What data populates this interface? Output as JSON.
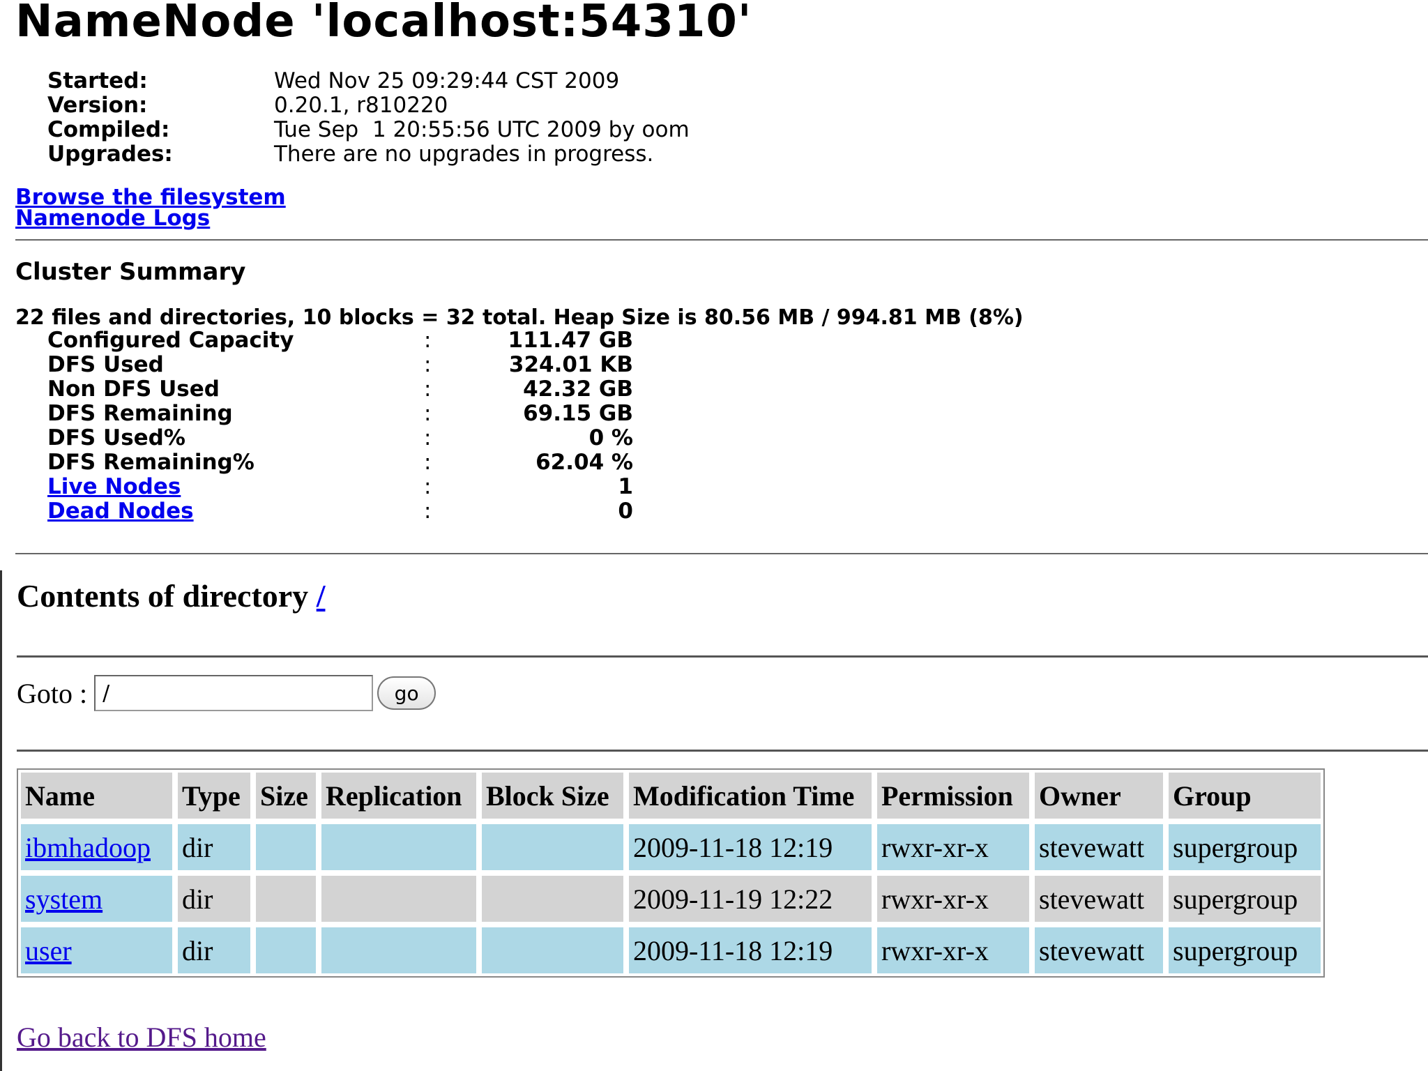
{
  "title": "NameNode 'localhost:54310'",
  "info": [
    {
      "key": "Started:",
      "value": "Wed Nov 25 09:29:44 CST 2009"
    },
    {
      "key": "Version:",
      "value": "0.20.1, r810220"
    },
    {
      "key": "Compiled:",
      "value": "Tue Sep  1 20:55:56 UTC 2009 by oom"
    },
    {
      "key": "Upgrades:",
      "value": "There are no upgrades in progress."
    }
  ],
  "links": {
    "browse": "Browse the filesystem",
    "logs": "Namenode Logs"
  },
  "cluster": {
    "title": "Cluster Summary",
    "summary_line": "22 files and directories, 10 blocks = 32 total. Heap Size is 80.56 MB / 994.81 MB (8%)",
    "stats": [
      {
        "key": "Configured Capacity",
        "value": "111.47 GB",
        "link": false
      },
      {
        "key": "DFS Used",
        "value": "324.01 KB",
        "link": false
      },
      {
        "key": "Non DFS Used",
        "value": "42.32 GB",
        "link": false
      },
      {
        "key": "DFS Remaining",
        "value": "69.15 GB",
        "link": false
      },
      {
        "key": "DFS Used%",
        "value": "0 %",
        "link": false
      },
      {
        "key": "DFS Remaining%",
        "value": "62.04 %",
        "link": false
      },
      {
        "key": "Live Nodes",
        "value": "1",
        "link": true
      },
      {
        "key": "Dead Nodes",
        "value": "0",
        "link": true
      }
    ],
    "separator": ":"
  },
  "directory": {
    "heading": "Contents of directory ",
    "path": "/",
    "goto_label": "Goto :",
    "goto_value": "/",
    "go_button": "go",
    "columns": [
      "Name",
      "Type",
      "Size",
      "Replication",
      "Block Size",
      "Modification Time",
      "Permission",
      "Owner",
      "Group"
    ],
    "rows": [
      {
        "name": "ibmhadoop",
        "type": "dir",
        "size": "",
        "replication": "",
        "block_size": "",
        "modified": "2009-11-18 12:19",
        "permission": "rwxr-xr-x",
        "owner": "stevewatt",
        "group": "supergroup"
      },
      {
        "name": "system",
        "type": "dir",
        "size": "",
        "replication": "",
        "block_size": "",
        "modified": "2009-11-19 12:22",
        "permission": "rwxr-xr-x",
        "owner": "stevewatt",
        "group": "supergroup"
      },
      {
        "name": "user",
        "type": "dir",
        "size": "",
        "replication": "",
        "block_size": "",
        "modified": "2009-11-18 12:19",
        "permission": "rwxr-xr-x",
        "owner": "stevewatt",
        "group": "supergroup"
      }
    ],
    "back_link": "Go back to DFS home"
  }
}
